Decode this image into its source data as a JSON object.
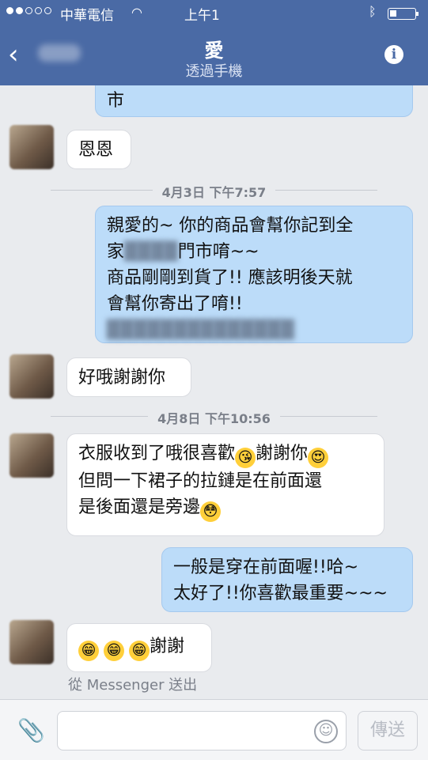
{
  "status": {
    "carrier": "中華電信",
    "time": "上午1"
  },
  "header": {
    "title": "愛",
    "subtitle": "透過手機"
  },
  "messages": {
    "m1": "市",
    "m2": "恩恩",
    "d1": "4月3日 下午7:57",
    "m3a": "親愛的~ 你的商品會幫你記到全",
    "m3b1": "家",
    "m3b2": "門市唷~~",
    "m3c": "商品剛剛到貨了!! 應該明後天就",
    "m3d": "會幫你寄出了唷!!",
    "m4": "好哦謝謝你",
    "d2": "4月8日 下午10:56",
    "m5a1": "衣服收到了哦很喜歡",
    "m5a2": "謝謝你",
    "m5b": "但問一下裙子的拉鏈是在前面還",
    "m5c": "是後面還是旁邊",
    "m6a": "一般是穿在前面喔!!哈~",
    "m6b": "太好了!!你喜歡最重要~~~",
    "m7": "謝謝"
  },
  "footnote": "從 Messenger 送出",
  "composer": {
    "send_label": "傳送"
  },
  "icons": [
    "back-chevron-icon",
    "info-icon",
    "paperclip-icon",
    "smiley-icon",
    "wifi-icon",
    "bluetooth-icon",
    "battery-icon"
  ],
  "colors": {
    "header": "#4a6aa5",
    "outgoing": "#bcdcf9",
    "incoming": "#ffffff",
    "background": "#e9ebee"
  }
}
